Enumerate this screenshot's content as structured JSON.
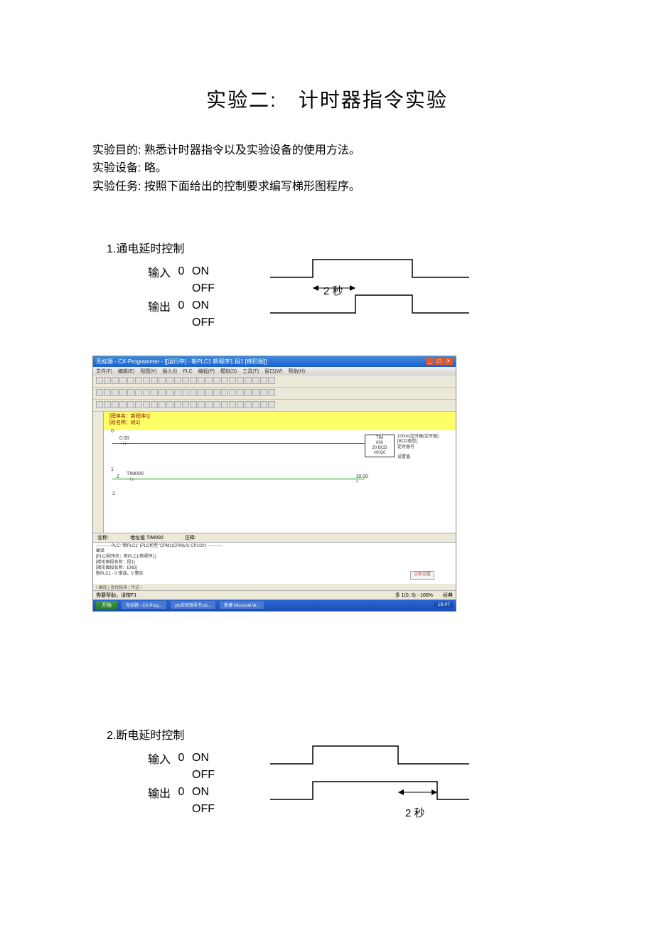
{
  "title": "实验二:　计时器指令实验",
  "intro": {
    "line1": "实验目的: 熟悉计时器指令以及实验设备的使用方法。",
    "line2": "实验设备: 略。",
    "line3": "实验任务: 按照下面给出的控制要求编写梯形图程序。"
  },
  "section1": {
    "heading": "1.通电延时控制",
    "input_label": "输入",
    "output_label": "输出",
    "zero": "0",
    "on": "ON",
    "off": "OFF",
    "delay_label": "2 秒"
  },
  "section2": {
    "heading": "2.断电延时控制",
    "input_label": "输入",
    "output_label": "输出",
    "zero": "0",
    "on": "ON",
    "off": "OFF",
    "delay_label": "2 秒"
  },
  "sim": {
    "window_title": "无标题 - CX-Programmer - [[运行中] - 新PLC1.新程序1.段1 [梯形图]]",
    "menu": [
      "文件(F)",
      "编辑(E)",
      "视图(V)",
      "插入(I)",
      "PLC",
      "编程(P)",
      "模拟(S)",
      "工具(T)",
      "窗口(W)",
      "帮助(H)"
    ],
    "highlight_line1": "[程序名：新程序1]",
    "highlight_line2": "[段名称：段1]",
    "ladder": {
      "rung0_num": "0",
      "contact0": "0.00",
      "tim_box": {
        "l1": "TIM",
        "l2": "000",
        "l3": "20 BCD",
        "l4": "#0020"
      },
      "annot": {
        "l1": "100ms定时器(定时器)[BCD类型]",
        "l2": "定时器号",
        "l3": "设置值"
      },
      "rung1_num": "1",
      "rung1_label": "2",
      "contact1": "TIM000",
      "coil1": "10.00",
      "rung2_num": "2"
    },
    "infobar": {
      "name_label": "名称:",
      "addr_label": "地址值",
      "addr_val": "TIM000",
      "comment_label": "注释:"
    },
    "output": {
      "header": "---------- PLC: '新PLC1' (PLC机型 'CPM1(CPM1A) CPU20') ----------",
      "line1": "编译",
      "line2": "[PLC/程序名：新PLC1/新程序1]",
      "line3": "[梯形图段名称：段1]",
      "line4": "[梯形图段名称：END]",
      "line5": "新PLC1 - 0 错误，0 警告",
      "button": "点取设置"
    },
    "tabs_text": "编译 | 查找报表 | 传送",
    "statusbar": {
      "left": "需要帮助，请按F1",
      "right": "多 1(0, 0) - 100%　　经典"
    },
    "taskbar": {
      "start": "开始",
      "items": [
        "无标题 - CX-Prog...",
        "plc实验指导书.do...",
        "新建 Microsoft W..."
      ],
      "tray": "15:47"
    }
  }
}
